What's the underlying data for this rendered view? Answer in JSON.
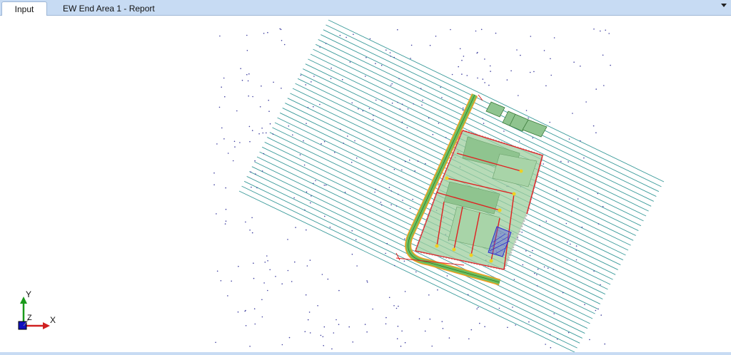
{
  "tabs": [
    {
      "label": "Input",
      "active": true
    },
    {
      "label": "EW End Area 1 - Report",
      "active": false
    }
  ],
  "viewport": {
    "ucs_icon": {
      "x_label": "X",
      "y_label": "Y",
      "z_label": "Z"
    },
    "colors": {
      "section_lines": "#3a9a9a",
      "surface_fill": "#9fcf9f",
      "boundary": "#e02020",
      "pond": "#3a3ad0",
      "points": "#4040a0",
      "road": "#6fbf5f"
    }
  }
}
